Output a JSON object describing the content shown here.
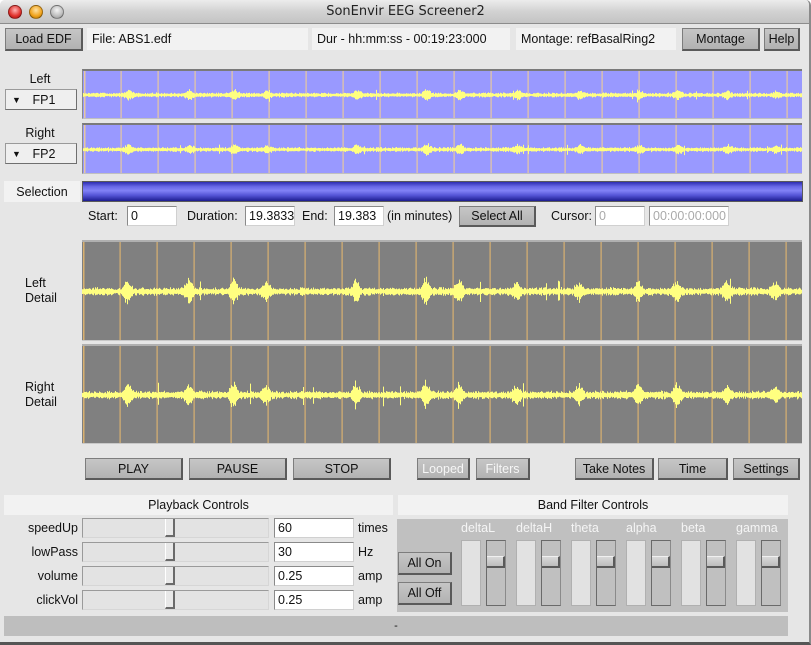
{
  "window": {
    "title": "SonEnvir EEG Screener2"
  },
  "toolbar": {
    "load_label": "Load EDF",
    "file_text": "File:  ABS1.edf",
    "duration_text": "Dur - hh:mm:ss - 00:19:23:000",
    "montage_text": "Montage:  refBasalRing2",
    "montage_button_label": "Montage",
    "help_label": "Help"
  },
  "channels": {
    "left": {
      "label": "Left",
      "selected": "FP1"
    },
    "right": {
      "label": "Right",
      "selected": "FP2"
    }
  },
  "selection": {
    "label": "Selection",
    "fraction_selected": 1.0,
    "start_label": "Start:",
    "start_value": "0",
    "duration_label": "Duration:",
    "duration_value": "19.3833",
    "end_label": "End:",
    "end_value": "19.383",
    "units_text": "(in minutes)",
    "select_all_label": "Select All",
    "cursor_label": "Cursor:",
    "cursor_value": "0",
    "cursor_time": "00:00:00:000"
  },
  "detail_views": {
    "left_label_1": "Left",
    "left_label_2": "Detail",
    "right_label_1": "Right",
    "right_label_2": "Detail"
  },
  "waveform": {
    "colors": {
      "overview_bg": "#9999ff",
      "detail_bg": "#808080",
      "signal": "#ffff80",
      "grid_overview": "#e6c8a0",
      "grid_detail": "#d8b070"
    },
    "grid_divisions": 13,
    "bursts": [
      {
        "pos": 0.063,
        "amp": 0.9
      },
      {
        "pos": 0.148,
        "amp": 0.85
      },
      {
        "pos": 0.21,
        "amp": 1.0
      },
      {
        "pos": 0.255,
        "amp": 0.7
      },
      {
        "pos": 0.38,
        "amp": 0.9
      },
      {
        "pos": 0.477,
        "amp": 1.1
      },
      {
        "pos": 0.523,
        "amp": 0.9
      },
      {
        "pos": 0.603,
        "amp": 0.8
      },
      {
        "pos": 0.69,
        "amp": 0.75
      },
      {
        "pos": 0.772,
        "amp": 0.8
      },
      {
        "pos": 0.826,
        "amp": 0.85
      },
      {
        "pos": 0.895,
        "amp": 0.8
      },
      {
        "pos": 0.0,
        "amp": 0
      },
      {
        "pos": 0.962,
        "amp": 0.6
      }
    ]
  },
  "transport": {
    "play_label": "PLAY",
    "pause_label": "PAUSE",
    "stop_label": "STOP",
    "looped_label": "Looped",
    "filters_label": "Filters",
    "take_notes_label": "Take Notes",
    "time_label": "Time",
    "settings_label": "Settings"
  },
  "playback": {
    "header": "Playback Controls",
    "params": [
      {
        "name": "speedUp",
        "value": "60",
        "unit": "times",
        "slider_fraction": 0.47
      },
      {
        "name": "lowPass",
        "value": "30",
        "unit": "Hz",
        "slider_fraction": 0.47
      },
      {
        "name": "volume",
        "value": "0.25",
        "unit": "amp",
        "slider_fraction": 0.47
      },
      {
        "name": "clickVol",
        "value": "0.25",
        "unit": "amp",
        "slider_fraction": 0.47
      }
    ]
  },
  "band_filter": {
    "header": "Band Filter Controls",
    "all_on_label": "All On",
    "all_off_label": "All Off",
    "bands": [
      {
        "name": "deltaL",
        "level": 0.7
      },
      {
        "name": "deltaH",
        "level": 0.7
      },
      {
        "name": "theta",
        "level": 0.7
      },
      {
        "name": "alpha",
        "level": 0.7
      },
      {
        "name": "beta",
        "level": 0.7
      },
      {
        "name": "gamma",
        "level": 0.7
      }
    ]
  },
  "status": {
    "text": "-"
  }
}
